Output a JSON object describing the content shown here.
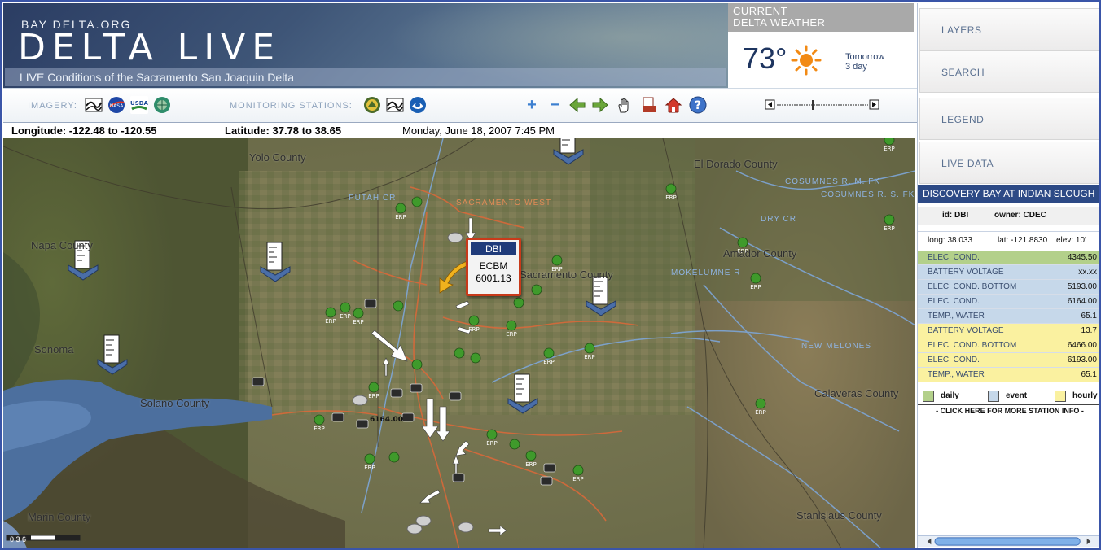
{
  "header": {
    "brand_small": "BAY DELTA.ORG",
    "title": "DELTA LIVE",
    "subtitle": "LIVE Conditions of the Sacramento San Joaquin Delta"
  },
  "weather": {
    "heading_line1": "CURRENT",
    "heading_line2": "DELTA WEATHER",
    "temperature": "73°",
    "forecast_line1": "Tomorrow",
    "forecast_line2": "3 day",
    "icon": "sun-icon"
  },
  "toolbar": {
    "imagery_label": "IMAGERY:",
    "monitoring_label": "MONITORING STATIONS:",
    "imagery_icons": [
      "landsat-icon",
      "nasa-icon",
      "usda-icon",
      "globe-icon"
    ],
    "station_icons": [
      "usgs-icon",
      "cdec-icon",
      "noaa-icon"
    ],
    "tools": [
      "zoom-in-icon",
      "zoom-out-icon",
      "pan-left-icon",
      "pan-right-icon",
      "hand-icon",
      "print-icon",
      "home-icon",
      "help-icon"
    ]
  },
  "coords": {
    "longitude": "Longitude: -122.48 to -120.55",
    "latitude": "Latitude: 37.78 to 38.65",
    "datetime": "Monday, June 18, 2007 7:45 PM"
  },
  "map": {
    "places": [
      "Yolo County",
      "El Dorado County",
      "Napa County",
      "Sacramento County",
      "Amador County",
      "Solano County",
      "Calaveras County",
      "Marin County",
      "Stanislaus County",
      "Sonoma"
    ],
    "rivers": [
      "SACRAMENTO WEST",
      "PUTAH CR",
      "COSUMNES R. S. FK",
      "COSUMNES R. M. FK",
      "DRY CR",
      "MOKELUMNE R",
      "NEW MELONES"
    ],
    "station_label": "ERP",
    "value_label": "6164.00",
    "popup": {
      "id": "DBI",
      "param": "ECBM",
      "value": "6001.13"
    },
    "scale_label": "0   3   6"
  },
  "panel": {
    "nav": [
      "LAYERS",
      "SEARCH",
      "LEGEND",
      "LIVE DATA"
    ],
    "station_title": "DISCOVERY BAY AT INDIAN SLOUGH",
    "station_id": "id: DBI",
    "station_owner": "owner: CDEC",
    "long": "long:  38.033",
    "lat": "lat: -121.8830",
    "elev": "elev: 10'",
    "readings": [
      {
        "label": "ELEC. COND.",
        "value": "4345.50",
        "type": "daily"
      },
      {
        "label": "BATTERY VOLTAGE",
        "value": "xx.xx",
        "type": "event"
      },
      {
        "label": "ELEC. COND. BOTTOM",
        "value": "5193.00",
        "type": "event"
      },
      {
        "label": "ELEC. COND.",
        "value": "6164.00",
        "type": "event"
      },
      {
        "label": "TEMP., WATER",
        "value": "65.1",
        "type": "event"
      },
      {
        "label": "BATTERY VOLTAGE",
        "value": "13.7",
        "type": "hourly"
      },
      {
        "label": "ELEC. COND. BOTTOM",
        "value": "6466.00",
        "type": "hourly"
      },
      {
        "label": "ELEC. COND.",
        "value": "6193.00",
        "type": "hourly"
      },
      {
        "label": "TEMP., WATER",
        "value": "65.1",
        "type": "hourly"
      }
    ],
    "legend": [
      {
        "label": "daily",
        "color": "#b3d08a"
      },
      {
        "label": "event",
        "color": "#c6d8ea"
      },
      {
        "label": "hourly",
        "color": "#faf1a0"
      }
    ],
    "more_info": "- CLICK HERE FOR MORE STATION INFO -"
  },
  "colors": {
    "daily": "#b3d08a",
    "event": "#c6d8ea",
    "hourly": "#faf1a0",
    "panel_title": "#2d4a86",
    "popup_border": "#c83a1a"
  }
}
